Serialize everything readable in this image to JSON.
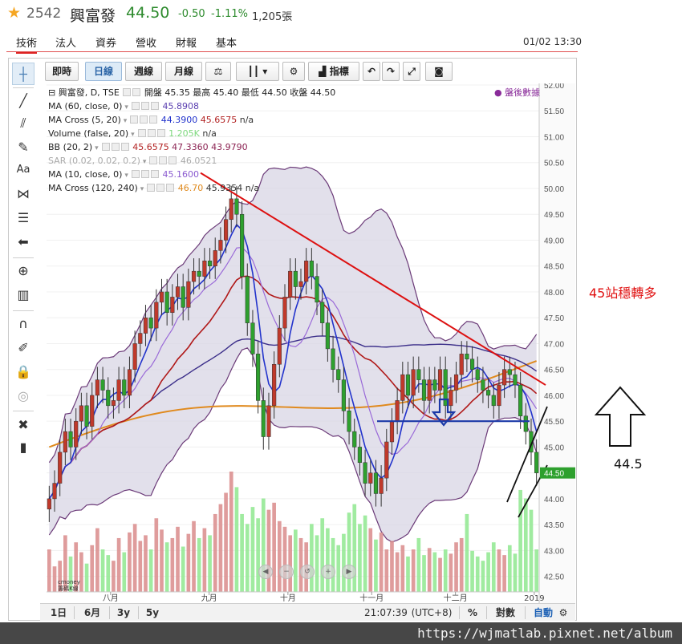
{
  "header": {
    "star": "★",
    "code": "2542",
    "name": "興富發",
    "price": "44.50",
    "change": "-0.50",
    "change_pct": "-1.11%",
    "volume": "1,205張"
  },
  "tabs": [
    {
      "label": "技術",
      "active": true
    },
    {
      "label": "法人",
      "active": false
    },
    {
      "label": "資券",
      "active": false
    },
    {
      "label": "營收",
      "active": false
    },
    {
      "label": "財報",
      "active": false
    },
    {
      "label": "基本",
      "active": false
    }
  ],
  "datetime": "01/02 13:30",
  "toolbar": {
    "intraday": "即時",
    "daily": "日線",
    "weekly": "週線",
    "monthly": "月線",
    "indicators": "指標"
  },
  "left_tools": [
    "crosshair-icon",
    "trendline-icon",
    "fork-icon",
    "brush-icon",
    "text-icon",
    "pattern-icon",
    "fib-icon",
    "arrow-left-icon",
    "zoom-icon",
    "measure-icon",
    "magnet-icon",
    "lock-drawing-icon",
    "lock-icon",
    "hide-icon",
    "settings-tools-icon",
    "trash-icon"
  ],
  "legend": {
    "title": "興富發, D, TSE",
    "ohlc": "開盤 45.35 最高 45.40 最低 44.50 收盤 44.50",
    "after_hours": "● 盤後數據",
    "rows": [
      {
        "label": "MA (60, close, 0)",
        "values": [
          "45.8908"
        ],
        "colors": [
          "#5a3fb0"
        ]
      },
      {
        "label": "MA Cross (5, 20)",
        "values": [
          "44.3900",
          "45.6575",
          "n/a"
        ],
        "colors": [
          "#2233cc",
          "#b22222",
          "#333333"
        ]
      },
      {
        "label": "Volume (false, 20)",
        "values": [
          "1.205K",
          "n/a"
        ],
        "colors": [
          "#7dd87d",
          "#333333"
        ]
      },
      {
        "label": "BB (20, 2)",
        "values": [
          "45.6575",
          "47.3360",
          "43.9790"
        ],
        "colors": [
          "#b22222",
          "#8b2252",
          "#8b2252"
        ]
      },
      {
        "label": "SAR (0.02, 0.02, 0.2)",
        "values": [
          "46.0521"
        ],
        "colors": [
          "#aaaaaa"
        ]
      },
      {
        "label": "MA (10, close, 0)",
        "values": [
          "45.1600"
        ],
        "colors": [
          "#8a5ad0"
        ]
      },
      {
        "label": "MA Cross (120, 240)",
        "values": [
          "46.70",
          "45.9354",
          "n/a"
        ],
        "colors": [
          "#e08a1e",
          "#333333",
          "#333333"
        ]
      }
    ]
  },
  "bottom_bar": {
    "ranges": [
      "1日",
      "6月",
      "3y",
      "5y"
    ],
    "time": "21:07:39",
    "tz": "(UTC+8)",
    "pct": "%",
    "log": "對數",
    "auto": "自動"
  },
  "logo_text": "cmoney 籌碼K線",
  "annotations": {
    "text": "45站穩轉多",
    "level": "44.5"
  },
  "watermark": "https://wjmatlab.pixnet.net/album",
  "colors": {
    "up": "#e06060",
    "down": "#2ea02e",
    "ma5": "#2233cc",
    "ma10": "#9a6ad8",
    "ma20": "#b01818",
    "ma60": "#3c2f8a",
    "ma120": "#e08a1e",
    "bb": "#6b3a78",
    "bb_fill": "#d8d6e4",
    "trendline": "#dd1111",
    "support": "#1c3aa8",
    "price_tag": "#2ea02e"
  },
  "chart_data": {
    "type": "candlestick",
    "title": "興富發, D, TSE",
    "ylim": [
      42.2,
      52.0
    ],
    "y_ticks": [
      "52.00",
      "51.50",
      "51.00",
      "50.50",
      "50.00",
      "49.50",
      "49.00",
      "48.50",
      "48.00",
      "47.50",
      "47.00",
      "46.50",
      "46.00",
      "45.50",
      "45.00",
      "44.50",
      "44.00",
      "43.50",
      "43.00",
      "42.50"
    ],
    "x_labels": [
      "八月",
      "九月",
      "十月",
      "十一月",
      "十二月",
      "2019"
    ],
    "last_price": "44.50",
    "close": [
      44.0,
      44.3,
      44.9,
      45.3,
      45.0,
      45.5,
      45.8,
      45.4,
      46.0,
      46.3,
      46.1,
      45.8,
      45.9,
      46.3,
      46.0,
      46.5,
      47.0,
      47.2,
      47.5,
      47.3,
      47.8,
      48.0,
      47.6,
      47.9,
      48.1,
      47.7,
      48.2,
      48.4,
      48.3,
      48.6,
      48.5,
      48.8,
      49.0,
      49.4,
      49.8,
      49.5,
      48.3,
      47.4,
      46.8,
      45.9,
      45.2,
      45.8,
      46.6,
      47.3,
      47.9,
      48.4,
      48.1,
      48.2,
      48.6,
      48.3,
      47.8,
      47.4,
      46.9,
      46.5,
      46.3,
      45.7,
      45.3,
      45.0,
      44.7,
      44.3,
      44.5,
      44.1,
      44.4,
      45.1,
      45.5,
      45.9,
      46.4,
      46.0,
      46.5,
      46.3,
      45.9,
      46.3,
      46.1,
      46.5,
      45.8,
      46.1,
      46.4,
      46.8,
      46.7,
      46.5,
      46.3,
      46.1,
      46.0,
      45.8,
      46.2,
      46.5,
      46.4,
      46.2,
      45.6,
      45.3,
      44.9,
      44.5
    ],
    "volume": [
      30,
      18,
      22,
      40,
      25,
      35,
      28,
      20,
      33,
      45,
      30,
      26,
      22,
      38,
      28,
      42,
      48,
      36,
      40,
      30,
      52,
      44,
      35,
      38,
      46,
      32,
      41,
      50,
      38,
      45,
      40,
      55,
      62,
      70,
      85,
      74,
      55,
      48,
      60,
      52,
      66,
      58,
      63,
      50,
      46,
      40,
      44,
      38,
      35,
      48,
      40,
      52,
      45,
      38,
      33,
      41,
      56,
      62,
      48,
      54,
      45,
      37,
      42,
      30,
      36,
      28,
      33,
      25,
      30,
      38,
      26,
      31,
      28,
      24,
      30,
      27,
      35,
      38,
      55,
      29,
      25,
      22,
      28,
      35,
      30,
      26,
      33,
      27,
      72,
      66,
      58,
      30
    ],
    "trendline": {
      "from": [
        250,
        50.3
      ],
      "to": [
        680,
        46.2
      ]
    },
    "support_line": 45.5
  }
}
